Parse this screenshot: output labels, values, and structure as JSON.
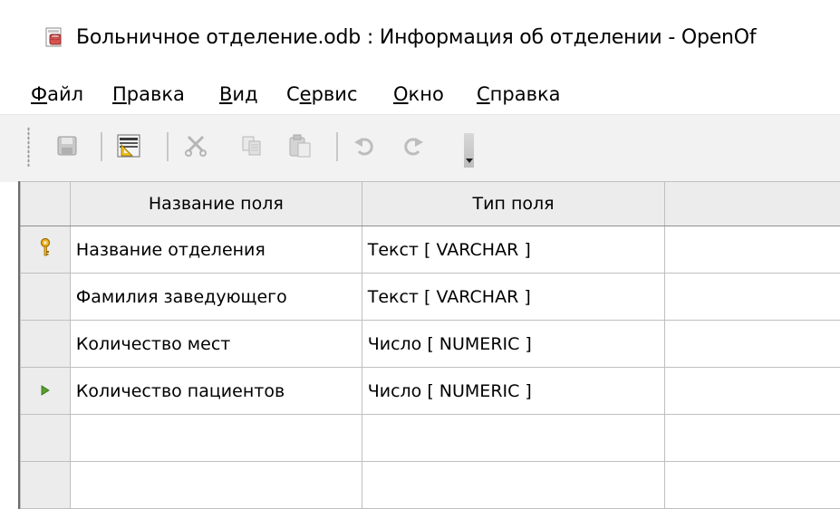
{
  "window": {
    "title": "Больничное отделение.odb : Информация об отделении - OpenOf",
    "icon": "base-document-icon"
  },
  "menu": [
    {
      "label": "Файл",
      "mnemonic": "Ф"
    },
    {
      "label": "Правка",
      "mnemonic": "П"
    },
    {
      "label": "Вид",
      "mnemonic": "В"
    },
    {
      "label": "Сервис",
      "mnemonic": "е"
    },
    {
      "label": "Окно",
      "mnemonic": "О"
    },
    {
      "label": "Справка",
      "mnemonic": "С"
    }
  ],
  "toolbar": {
    "buttons": [
      "save-icon",
      "design-icon",
      "cut-icon",
      "copy-icon",
      "paste-icon",
      "undo-icon",
      "redo-icon"
    ]
  },
  "grid": {
    "columns": [
      "Название поля",
      "Тип поля",
      ""
    ],
    "rows": [
      {
        "marker": "primary-key-icon",
        "name": "Название отделения",
        "type": "Текст [ VARCHAR ]"
      },
      {
        "marker": "",
        "name": "Фамилия заведующего",
        "type": "Текст [ VARCHAR ]"
      },
      {
        "marker": "",
        "name": "Количество мест",
        "type": "Число [ NUMERIC ]"
      },
      {
        "marker": "current-row-icon",
        "name": "Количество пациентов",
        "type": "Число [ NUMERIC ]"
      },
      {
        "marker": "",
        "name": "",
        "type": ""
      },
      {
        "marker": "",
        "name": "",
        "type": ""
      }
    ]
  },
  "colors": {
    "header_bg": "#ececec",
    "toolbar_bg": "#f2f2f2",
    "key_icon": "#e0a10a",
    "current_row_arrow": "#5aa02c"
  }
}
